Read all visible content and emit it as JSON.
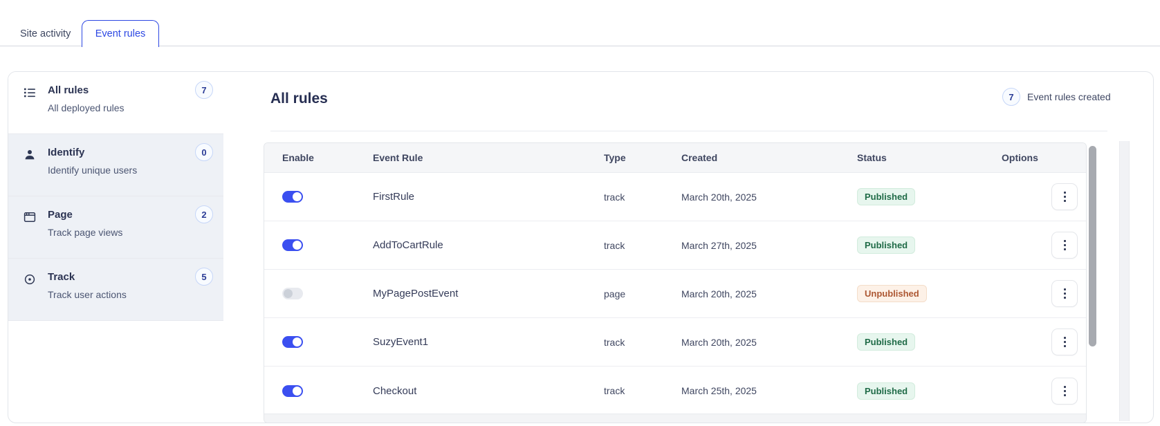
{
  "tabs": [
    {
      "label": "Site activity",
      "active": false
    },
    {
      "label": "Event rules",
      "active": true
    }
  ],
  "sidebar": {
    "items": [
      {
        "icon": "list-icon",
        "title": "All rules",
        "subtitle": "All deployed rules",
        "count": "7",
        "selected": true
      },
      {
        "icon": "person-icon",
        "title": "Identify",
        "subtitle": "Identify unique users",
        "count": "0",
        "selected": false
      },
      {
        "icon": "window-icon",
        "title": "Page",
        "subtitle": "Track page views",
        "count": "2",
        "selected": false
      },
      {
        "icon": "target-icon",
        "title": "Track",
        "subtitle": "Track user actions",
        "count": "5",
        "selected": false
      }
    ]
  },
  "main": {
    "title": "All rules",
    "summary_count": "7",
    "summary_label": "Event rules created",
    "table": {
      "columns": [
        "Enable",
        "Event Rule",
        "Type",
        "Created",
        "Status",
        "Options"
      ],
      "rows": [
        {
          "enabled": true,
          "name": "FirstRule",
          "type": "track",
          "created": "March 20th, 2025",
          "status": "Published"
        },
        {
          "enabled": true,
          "name": "AddToCartRule",
          "type": "track",
          "created": "March 27th, 2025",
          "status": "Published"
        },
        {
          "enabled": false,
          "name": "MyPagePostEvent",
          "type": "page",
          "created": "March 20th, 2025",
          "status": "Unpublished"
        },
        {
          "enabled": true,
          "name": "SuzyEvent1",
          "type": "track",
          "created": "March 20th, 2025",
          "status": "Published"
        },
        {
          "enabled": true,
          "name": "Checkout",
          "type": "track",
          "created": "March 25th, 2025",
          "status": "Published"
        }
      ]
    }
  },
  "colors": {
    "accent_blue": "#2c47e3",
    "toggle_on": "#3b4ff0",
    "published_bg": "#e7f6ee",
    "published_text": "#1f6b47",
    "unpublished_bg": "#fdf1e7",
    "unpublished_text": "#ad5732",
    "count_badge_border": "#c6d6f8",
    "count_badge_text": "#2b3c96",
    "scrollbar_thumb": "#a7aab0"
  }
}
